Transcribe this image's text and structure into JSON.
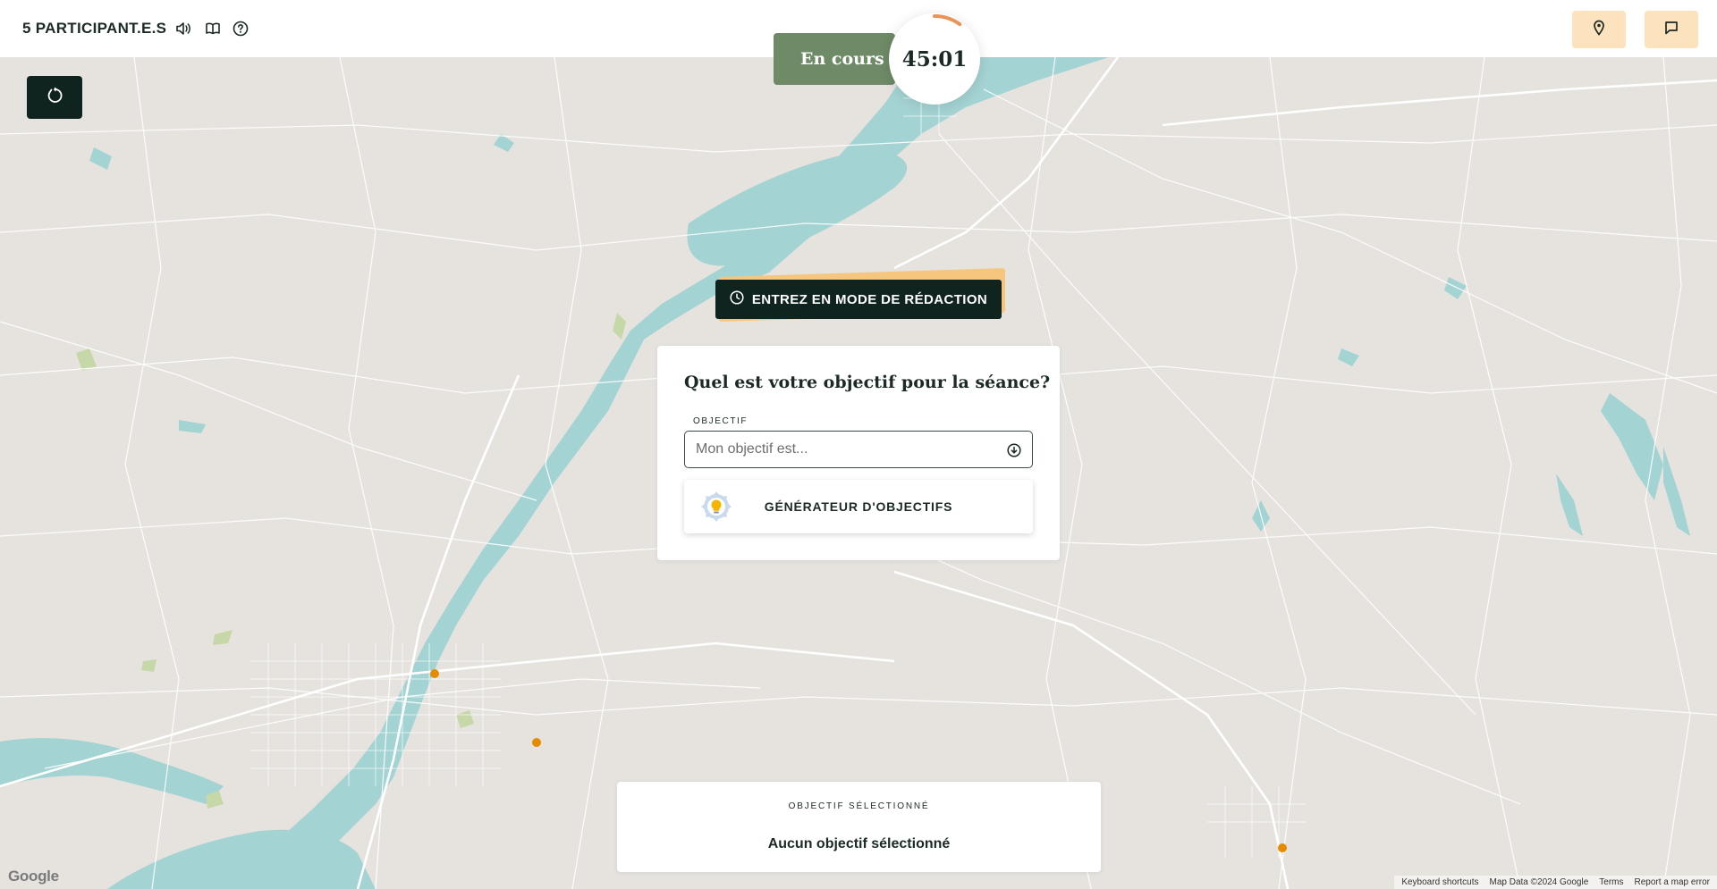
{
  "header": {
    "participants": "5 PARTICIPANT.E.S",
    "icons": [
      "volume-icon",
      "book-icon",
      "help-icon"
    ],
    "right_buttons": [
      "location-pin-icon",
      "chat-icon"
    ]
  },
  "session": {
    "status": "En cours",
    "timer": "45:01",
    "timer_progress": 0.1
  },
  "draft_button": {
    "label": "ENTREZ EN MODE DE RÉDACTION",
    "icon": "clock-icon"
  },
  "objective_card": {
    "title": "Quel est votre objectif pour la séance?",
    "field_label": "OBJECTIF",
    "placeholder": "Mon objectif est...",
    "value": "",
    "generator_label": "GÉNÉRATEUR D'OBJECTIFS"
  },
  "selected": {
    "label": "OBJECTIF SÉLECTIONNÉ",
    "value": "Aucun objectif sélectionné"
  },
  "map": {
    "logo": "Google",
    "footer": {
      "shortcuts": "Keyboard shortcuts",
      "data": "Map Data ©2024 Google",
      "terms": "Terms",
      "report": "Report a map error"
    }
  },
  "colors": {
    "accent_dark": "#10241f",
    "status_green": "#6e8a66",
    "button_cream": "#fde3bd",
    "highlight_orange": "#f6c67e",
    "timer_arc": "#e9935a",
    "map_land": "#e6e3df",
    "map_water": "#a4d3d3",
    "map_marker": "#e68a00"
  }
}
